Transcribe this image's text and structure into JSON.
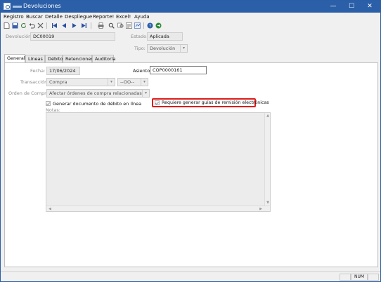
{
  "window": {
    "title": "Devoluciones",
    "minimize": "—",
    "maximize": "☐",
    "close": "✕"
  },
  "menu": [
    "Registro",
    "Buscar",
    "Detalle",
    "Despliegue",
    "Reporte!",
    "Excel!",
    "Ayuda"
  ],
  "header": {
    "devolucion_label": "Devolución:",
    "devolucion_value": "DC00019",
    "estado_label": "Estado:",
    "estado_value": "Aplicada",
    "tipo_label": "Tipo:",
    "tipo_value": "Devolución"
  },
  "tabs": [
    "General",
    "Líneas",
    "Débito",
    "Retenciones",
    "Auditoría"
  ],
  "general": {
    "fecha_label": "Fecha:",
    "fecha_value": "17/06/2024",
    "asiento_label": "Asiento:",
    "asiento_value": "COP0000161",
    "transaccion_label": "Transacción:",
    "transaccion_value": "Compra",
    "transaccion_sub": "--OO--",
    "orden_label": "Orden de Compra:",
    "orden_value": "Afectar órdenes de compra relacionadas",
    "generar_debito_label": "Generar documento de débito en línea",
    "guias_label": "Requiere generar guías de remisión electrónicas",
    "notas_label": "Notas:"
  },
  "status": {
    "num": "NUM"
  }
}
